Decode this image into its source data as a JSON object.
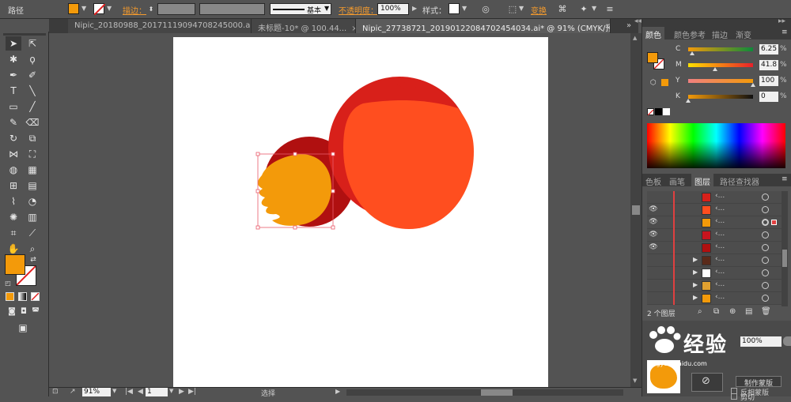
{
  "control_bar": {
    "object_type": "路径",
    "stroke_label": "描边：",
    "stroke_profile": "基本",
    "opacity_label": "不透明度：",
    "opacity_value": "100%",
    "style_label": "样式：",
    "transform_label": "变换",
    "fill_color": "#f39a0a"
  },
  "tabs": [
    {
      "label": "Nipic_20180988_20171119094708245000.ai*",
      "close": "×"
    },
    {
      "label": "未标题-10* @ 100.44...",
      "close": "×"
    },
    {
      "label": "Nipic_27738721_20190122084702454034.ai* @ 91% (CMYK/预览)",
      "close": "×"
    }
  ],
  "tab_overflow": "»",
  "color_panel": {
    "tabs": [
      "颜色",
      "颜色参考",
      "描边",
      "渐变"
    ],
    "channels": [
      {
        "name": "C",
        "value": "6.25",
        "unit": "%",
        "level": 0.0625
      },
      {
        "name": "M",
        "value": "41.8",
        "unit": "%",
        "level": 0.418
      },
      {
        "name": "Y",
        "value": "100",
        "unit": "%",
        "level": 1.0
      },
      {
        "name": "K",
        "value": "0",
        "unit": "%",
        "level": 0.0
      }
    ]
  },
  "layers_panel": {
    "tabs": [
      "色板",
      "画笔",
      "图层",
      "路径查找器"
    ],
    "row_label": "‹...",
    "count_label": "2 个图层",
    "rows": [
      {
        "eye": false,
        "expand": false,
        "thumb": "#d8201a"
      },
      {
        "eye": true,
        "expand": false,
        "thumb": "#ff4e1f"
      },
      {
        "eye": true,
        "expand": false,
        "thumb": "#f39a0a",
        "selected": true
      },
      {
        "eye": true,
        "expand": false,
        "thumb": "#c8141e"
      },
      {
        "eye": true,
        "expand": false,
        "thumb": "#b01010"
      },
      {
        "eye": false,
        "expand": true,
        "thumb": "#5a2a1a"
      },
      {
        "eye": false,
        "expand": true,
        "thumb": "#ffffff"
      },
      {
        "eye": false,
        "expand": true,
        "thumb": "#e0a030"
      },
      {
        "eye": false,
        "expand": true,
        "thumb": "#f39a0a"
      }
    ]
  },
  "transparency_panel": {
    "opacity": "100%",
    "make_mask": "制作蒙版",
    "clip": "剪切",
    "invert_mask": "反相蒙版"
  },
  "status_bar": {
    "zoom": "91%",
    "page": "1",
    "tool": "选择"
  },
  "watermark": {
    "text": "经验",
    "site": "jingyan.baidu.com"
  },
  "colors": {
    "orange": "#f39a0a",
    "red_light": "#ff4e1f",
    "red": "#d8201a",
    "dark_red": "#b01010"
  }
}
